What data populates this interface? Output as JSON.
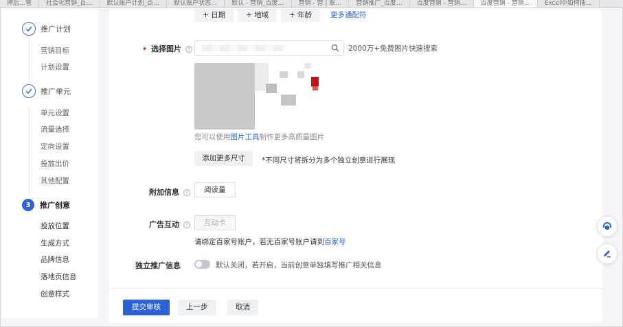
{
  "browser_tabs": [
    "押后…管",
    "社会化营销_百…",
    "默认账户计划_百…",
    "默认账户状态…",
    "默认 - 营销_百度…",
    "营销 - 营 | 账…",
    "营销推广_百度…",
    "百度营销 - 营销…",
    "百度营销 - 营销…",
    "Excel中如何插…"
  ],
  "sidebar": {
    "steps": [
      {
        "label": "推广计划",
        "state": "done",
        "items": [
          "营销目标",
          "计划设置"
        ]
      },
      {
        "label": "推广单元",
        "state": "done",
        "items": [
          "单元设置",
          "流量选择",
          "定向设置",
          "投放出价",
          "其他配置"
        ]
      },
      {
        "label": "推广创意",
        "state": "current",
        "number": "3",
        "items": [
          "投放位置",
          "生成方式",
          "品牌信息",
          "落地页信息",
          "创意样式"
        ]
      }
    ]
  },
  "form": {
    "tag_buttons": [
      "+ 日期",
      "+ 地域",
      "+ 年龄"
    ],
    "more_wildcards": "更多通配符",
    "select_image_label": "选择图片",
    "search_hint": "2000万+免费图片快速搜索",
    "tool_note_prefix": "您可以使用",
    "tool_link": "图片工具",
    "tool_note_suffix": "制作更多高质量图片",
    "add_sizes_button": "添加更多尺寸",
    "sizes_tip": "*不同尺寸将拆分为多个独立创意进行展现",
    "extra_info_label": "附加信息",
    "extra_info_chip": "阅读量",
    "ad_interaction_label": "广告互动",
    "ad_interaction_chip": "互动卡",
    "bind_hint_prefix": "请绑定百家号账户，若无百家号账户请到",
    "bind_hint_link": "百家号",
    "independent_label": "独立推广信息",
    "independent_toggle_text": "默认关闭，若开启，当前创意单独填写推广相关信息",
    "independent_toggle_on": false
  },
  "footer": {
    "submit": "提交审核",
    "prev": "上一步",
    "cancel": "取消"
  },
  "float_buttons": [
    "customer-service-icon",
    "edit-feedback-icon"
  ],
  "colors": {
    "accent": "#2c62d6",
    "required": "#e0302c",
    "link": "#2a62d8"
  }
}
